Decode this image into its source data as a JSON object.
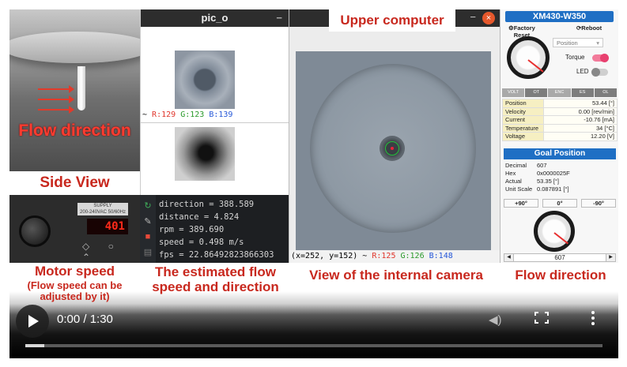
{
  "side": {
    "overlay": "Flow direction",
    "caption": "Side View"
  },
  "motor_ui": {
    "label": "SUPPLY\n200-240VAC 50/60Hz",
    "display": "401"
  },
  "pic": {
    "title": "pic_o",
    "rgb_prefix": "~ ",
    "r": "R:129",
    "g": "G:123",
    "b": "B:139"
  },
  "terminal": {
    "lines": [
      "direction = 388.589",
      "distance = 4.824",
      "rpm = 389.690",
      "speed = 0.498 m/s",
      "fps = 22.86492823866303"
    ]
  },
  "camera": {
    "header_label": "Upper computer",
    "coords": "(x=252, y=152) ~ ",
    "r": "R:125",
    "g": "G:126",
    "b": "B:148"
  },
  "dxl": {
    "title": "XM430-W350",
    "factory_reset": "Factory Reset",
    "reboot": "Reboot",
    "mode": "Position",
    "torque_label": "Torque",
    "led_label": "LED",
    "torque_on": true,
    "led_on": false,
    "error_tabs": [
      "VOLT",
      "OT",
      "ENC",
      "ES",
      "OL"
    ],
    "info": [
      {
        "k": "Position",
        "v": "53.44 [°]"
      },
      {
        "k": "Velocity",
        "v": "0.00 [rev/min]"
      },
      {
        "k": "Current",
        "v": "-10.76 [mA]"
      },
      {
        "k": "Temperature",
        "v": "34 [°C]"
      },
      {
        "k": "Voltage",
        "v": "12.20 [V]"
      }
    ],
    "goal_title": "Goal Position",
    "goal": [
      {
        "k": "Decimal",
        "v": "607"
      },
      {
        "k": "Hex",
        "v": "0x0000025F"
      },
      {
        "k": "Actual",
        "v": "53.35 [°]"
      },
      {
        "k": "Unit Scale",
        "v": "0.087891 [°]"
      }
    ],
    "presets": [
      "+90°",
      "0°",
      "-90°"
    ],
    "spin_value": "607",
    "accent": "#1f6fc4"
  },
  "captions": {
    "motor_speed": "Motor speed",
    "motor_note": "(Flow speed can be adjusted by it)",
    "estimated": "The estimated flow speed and direction",
    "internal": "View of the internal camera",
    "flow_direction": "Flow direction",
    "color": "#c8281e"
  },
  "player": {
    "time": "0:00 / 1:30",
    "progress_fraction": 0.033
  }
}
